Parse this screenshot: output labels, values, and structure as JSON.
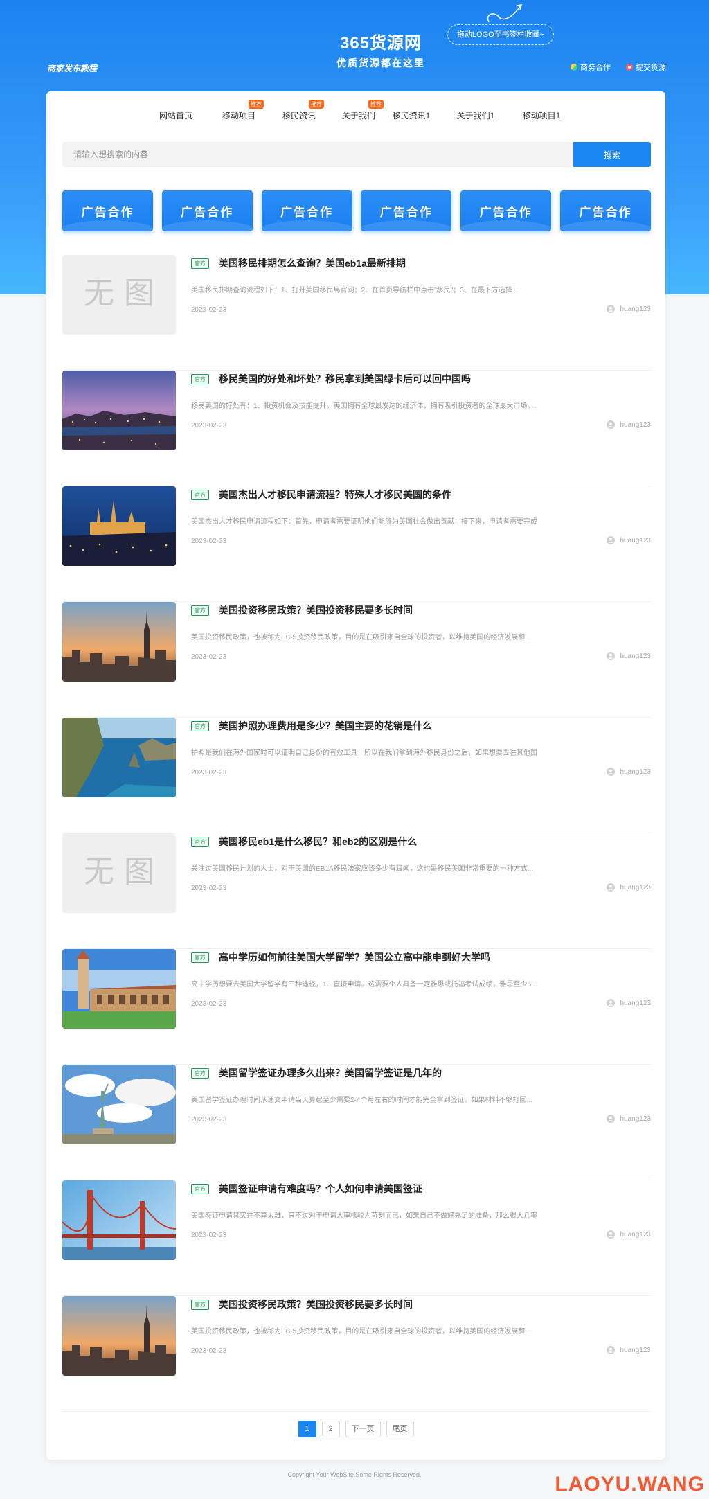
{
  "header": {
    "merchant_publish": "商家发布教程",
    "logo_title": "365货源网",
    "logo_slogan": "优质货源都在这里",
    "drag_hint": "拖动LOGO至书签栏收藏~",
    "links": [
      {
        "label": "商务合作",
        "icon": "coin-icon"
      },
      {
        "label": "提交货源",
        "icon": "submit-icon"
      }
    ]
  },
  "nav": {
    "items": [
      {
        "label": "网站首页",
        "badge": ""
      },
      {
        "label": "移动项目",
        "badge": "推荐"
      },
      {
        "label": "移民资讯",
        "badge": "推荐"
      },
      {
        "label": "关于我们",
        "badge": "推荐"
      },
      {
        "label": "移民资讯1",
        "badge": ""
      },
      {
        "label": "关于我们1",
        "badge": ""
      },
      {
        "label": "移动项目1",
        "badge": ""
      }
    ]
  },
  "search": {
    "placeholder": "请输入想搜索的内容",
    "button": "搜索"
  },
  "ads": [
    "广告合作",
    "广告合作",
    "广告合作",
    "广告合作",
    "广告合作",
    "广告合作"
  ],
  "articles": [
    {
      "thumb": "no-image",
      "no_image_text": "无 图",
      "tag": "官方",
      "title": "美国移民排期怎么查询？美国eb1a最新排期",
      "summary": "美国移民排期查询流程如下：1、打开美国移民局官网；2、在首页导航栏中点击\"移民\"；3、在最下方选择...",
      "date": "2023-02-23",
      "author": "huang123"
    },
    {
      "thumb": "city-night",
      "tag": "官方",
      "title": "移民美国的好处和坏处？移民拿到美国绿卡后可以回中国吗",
      "summary": "移民美国的好处有：1、投资机会及技能提升。美国拥有全球最发达的经济体，拥有吸引投资者的全球最大市场。...",
      "date": "2023-02-23",
      "author": "huang123"
    },
    {
      "thumb": "castle-night",
      "tag": "官方",
      "title": "美国杰出人才移民申请流程？特殊人才移民美国的条件",
      "summary": "美国杰出人才移民申请流程如下：首先，申请者需要证明他们能够为美国社会做出贡献；接下来，申请者需要完成...",
      "date": "2023-02-23",
      "author": "huang123"
    },
    {
      "thumb": "skyline-sunset",
      "tag": "官方",
      "title": "美国投资移民政策？美国投资移民要多长时间",
      "summary": "美国投资移民政策，也被称为EB-5投资移民政策，目的是在吸引来自全球的投资者，以维持美国的经济发展和...",
      "date": "2023-02-23",
      "author": "huang123"
    },
    {
      "thumb": "coast",
      "tag": "官方",
      "title": "美国护照办理费用是多少？美国主要的花销是什么",
      "summary": "护照是我们在海外国家时可以证明自己身份的有效工具，所以在我们拿到海外移民身份之后，如果想要去往其他国...",
      "date": "2023-02-23",
      "author": "huang123"
    },
    {
      "thumb": "no-image",
      "no_image_text": "无 图",
      "tag": "官方",
      "title": "美国移民eb1是什么移民？和eb2的区别是什么",
      "summary": "关注过美国移民计划的人士，对于美国的EB1A移民法案应该多少有耳闻，这也是移民美国非常重要的一种方式...",
      "date": "2023-02-23",
      "author": "huang123"
    },
    {
      "thumb": "university",
      "tag": "官方",
      "title": "高中学历如何前往美国大学留学？美国公立高中能申到好大学吗",
      "summary": "高中学历想要去美国大学留学有三种途径，1、直接申请。这需要个人具备一定雅思或托福考试成绩，雅思至少6...",
      "date": "2023-02-23",
      "author": "huang123"
    },
    {
      "thumb": "liberty",
      "tag": "官方",
      "title": "美国留学签证办理多久出来？美国留学签证是几年的",
      "summary": "美国留学签证办理时间从递交申请当天算起至少需要2-4个月左右的时间才能完全拿到签证。如果材料不够打回...",
      "date": "2023-02-23",
      "author": "huang123"
    },
    {
      "thumb": "bridge",
      "tag": "官方",
      "title": "美国签证申请有难度吗？个人如何申请美国签证",
      "summary": "美国签证申请其实并不算太难，只不过对于申请人审核较为苛刻而已，如果自己不做好充足的准备，那么很大几率...",
      "date": "2023-02-23",
      "author": "huang123"
    },
    {
      "thumb": "skyline-sunset",
      "tag": "官方",
      "title": "美国投资移民政策？美国投资移民要多长时间",
      "summary": "美国投资移民政策，也被称为EB-5投资移民政策，目的是在吸引来自全球的投资者，以维持美国的经济发展和...",
      "date": "2023-02-23",
      "author": "huang123"
    }
  ],
  "pagination": {
    "pages": [
      "1",
      "2"
    ],
    "current": "1",
    "next": "下一页",
    "last": "尾页"
  },
  "footer": "Copyright Your WebSite.Some Rights Reserved.",
  "watermark": "LAOYU.WANG",
  "colors": {
    "primary": "#1a86f0",
    "tag_green": "#1aa05a",
    "badge_orange": "#ff6a1a",
    "watermark": "#f25a33"
  }
}
